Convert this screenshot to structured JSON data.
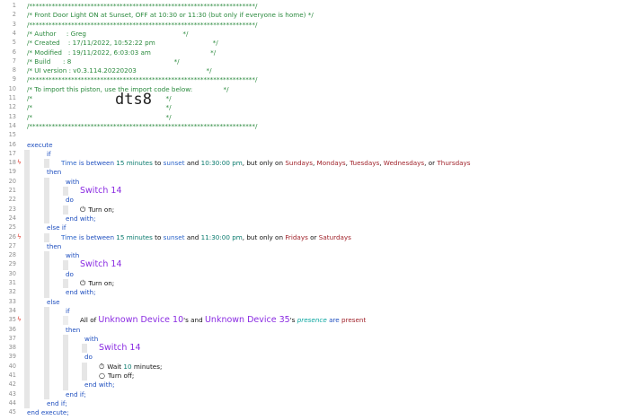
{
  "comment_lines": [
    "/**********************************************************************/",
    "/* Front Door Light ON at Sunset, OFF at 10:30 or 11:30 (but only if everyone is home) */",
    "/**********************************************************************/",
    "/* Author     : Greg                                               */",
    "/* Created    : 17/11/2022, 10:52:22 pm                            */",
    "/* Modified   : 19/11/2022, 6:03:03 am                             */",
    "/* Build      : 8                                                  */",
    "/* UI version : v0.3.114.20220203                                  */",
    "/**********************************************************************/",
    "/* To import this piston, use the import code below:               */",
    "/*                                                                 */",
    "/*                                                                 */",
    "/*                                                                 */",
    "/**********************************************************************/"
  ],
  "import_code": "dts8",
  "line_numbers": [
    "1",
    "2",
    "3",
    "4",
    "5",
    "6",
    "7",
    "8",
    "9",
    "10",
    "11",
    "12",
    "13",
    "14",
    "15",
    "16",
    "17",
    "18",
    "19",
    "20",
    "21",
    "22",
    "23",
    "24",
    "25",
    "26",
    "27",
    "28",
    "29",
    "30",
    "31",
    "32",
    "33",
    "34",
    "35",
    "36",
    "37",
    "38",
    "39",
    "40",
    "41",
    "42",
    "43",
    "44",
    "45"
  ],
  "keywords": {
    "execute": "execute",
    "if": "if",
    "then": "then",
    "with": "with",
    "do": "do",
    "end_with": "end with;",
    "else_if": "else if",
    "else": "else",
    "end_if": "end if;",
    "end_execute": "end execute;"
  },
  "condition1": {
    "time": "Time",
    "is_between": "is between",
    "num": "15",
    "minutes_to": "minutes",
    "to": "to",
    "sunset": "sunset",
    "and": "and",
    "end_time": "10:30:00 pm",
    "but_only_on": ", but only on",
    "days": [
      "Sundays",
      "Mondays",
      "Tuesdays",
      "Wednesdays"
    ],
    "or": ", or",
    "last_day": "Thursdays"
  },
  "condition2": {
    "time": "Time",
    "is_between": "is between",
    "num": "15",
    "minutes": "minutes",
    "to": "to",
    "sunset": "sunset",
    "and": "and",
    "end_time": "11:30:00 pm",
    "but_only_on": ", but only on",
    "day1": "Fridays",
    "or": "or",
    "day2": "Saturdays"
  },
  "condition3": {
    "all_of": "All of",
    "device1": "Unknown Device 10",
    "apos_s": "'s and",
    "device2": "Unknown Device 35",
    "apos_s2": "'s",
    "attribute": "presence",
    "are": "are",
    "value": "present"
  },
  "device": "Switch 14",
  "actions": {
    "turn_on": "Turn on;",
    "wait": "Wait",
    "wait_num": "10",
    "wait_unit": "minutes;",
    "turn_off": "Turn off;"
  },
  "icons": [
    "power-icon",
    "clock-icon",
    "circle-icon",
    "bolt-icon"
  ]
}
